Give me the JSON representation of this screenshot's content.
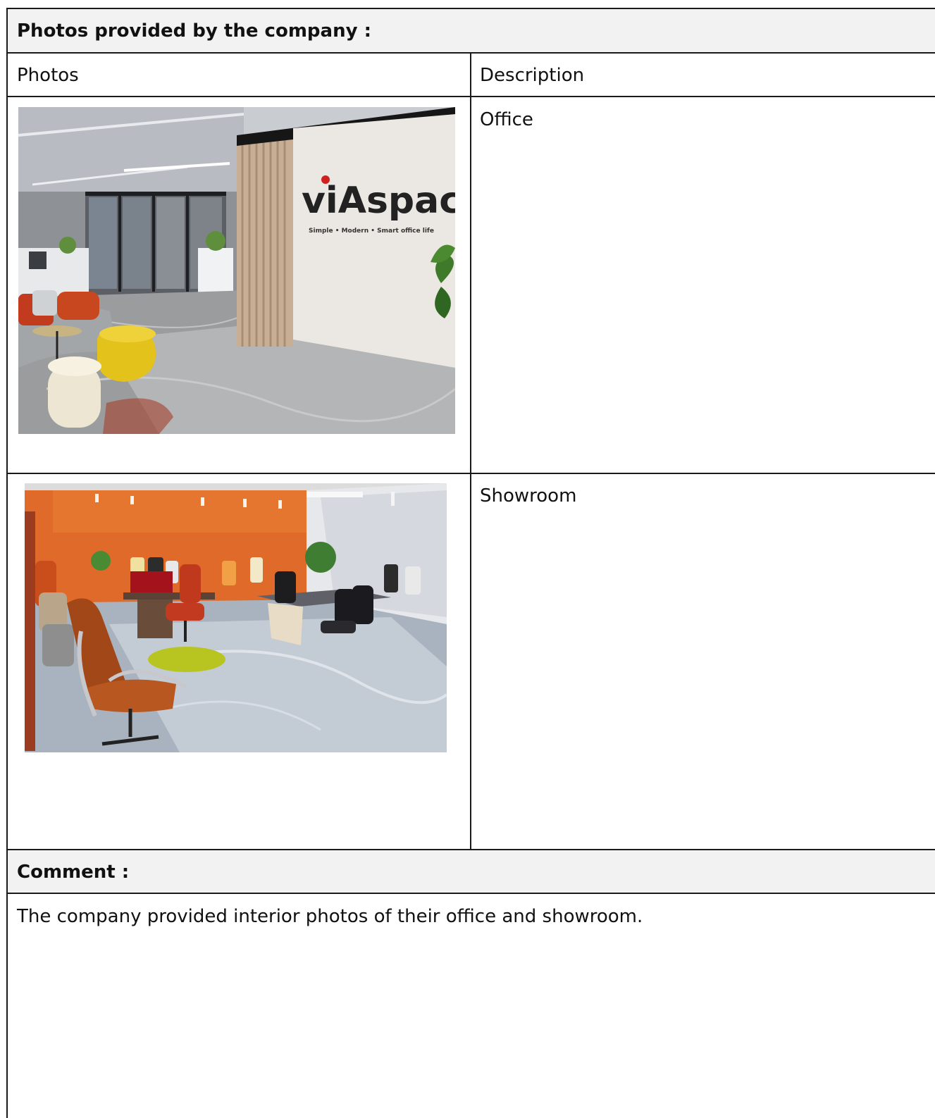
{
  "section_title": "Photos provided by the company :",
  "table": {
    "headers": {
      "photos": "Photos",
      "description": "Description"
    },
    "rows": [
      {
        "photo_alt": "Office interior with viAspace logo wall",
        "description": "Office",
        "logo_text": "viAspace",
        "logo_tagline": "Simple • Modern • Smart office life"
      },
      {
        "photo_alt": "Showroom with office chairs and orange wall",
        "description": "Showroom"
      }
    ]
  },
  "comment": {
    "title": "Comment :",
    "text": "The company provided interior photos of their office and showroom."
  }
}
